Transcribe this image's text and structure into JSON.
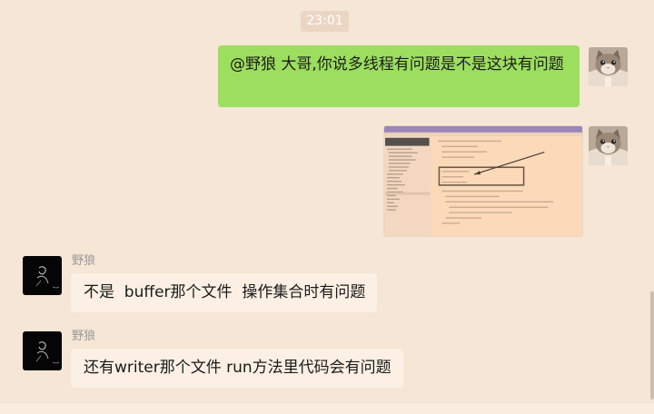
{
  "chat": {
    "timestamp": "23:01",
    "messages": [
      {
        "from": "self",
        "type": "text",
        "text": "@野狼 大哥,你说多线程有问题是不是这块有问题"
      },
      {
        "from": "self",
        "type": "image",
        "avatar_icon": "cat-avatar-icon"
      },
      {
        "from": "other",
        "sender": "野狼",
        "type": "text",
        "text": "不是  buffer那个文件  操作集合时有问题"
      },
      {
        "from": "other",
        "sender": "野狼",
        "type": "text",
        "text": "还有writer那个文件 run方法里代码会有问题"
      }
    ]
  },
  "colors": {
    "background": "#f5e6d6",
    "self_bubble": "#9cde5e",
    "other_bubble": "#fbf0e3",
    "timestamp_bg": "#ebd6c4"
  }
}
